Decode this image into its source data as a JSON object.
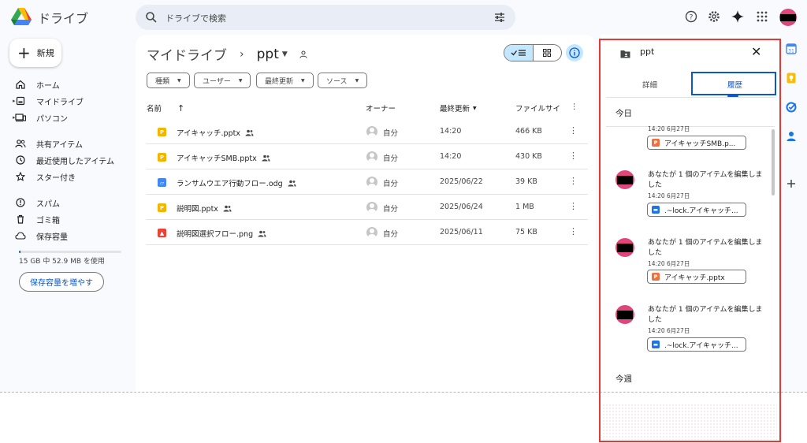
{
  "header": {
    "app_title": "ドライブ",
    "search_placeholder": "ドライブで検索"
  },
  "sidebar": {
    "new_label": "新規",
    "items": [
      {
        "label": "ホーム",
        "icon": "home-icon"
      },
      {
        "label": "マイドライブ",
        "icon": "drive-icon"
      },
      {
        "label": "パソコン",
        "icon": "computer-icon"
      },
      {
        "label": "共有アイテム",
        "icon": "shared-icon"
      },
      {
        "label": "最近使用したアイテム",
        "icon": "clock-icon"
      },
      {
        "label": "スター付き",
        "icon": "star-icon"
      },
      {
        "label": "スパム",
        "icon": "spam-icon"
      },
      {
        "label": "ゴミ箱",
        "icon": "trash-icon"
      },
      {
        "label": "保存容量",
        "icon": "cloud-icon"
      }
    ],
    "storage_text": "15 GB 中 52.9 MB を使用",
    "storage_fraction": 0.0034,
    "storage_button": "保存容量を増やす"
  },
  "main": {
    "breadcrumb_root": "マイドライブ",
    "breadcrumb_current": "ppt",
    "filters": [
      "種類",
      "ユーザー",
      "最終更新",
      "ソース"
    ],
    "columns": {
      "name": "名前",
      "owner": "オーナー",
      "modified": "最終更新",
      "size": "ファイルサイ"
    },
    "files": [
      {
        "name": "アイキャッチ.pptx",
        "type": "slides",
        "owner": "自分",
        "modified": "14:20",
        "size": "466 KB"
      },
      {
        "name": "アイキャッチSMB.pptx",
        "type": "slides",
        "owner": "自分",
        "modified": "14:20",
        "size": "430 KB"
      },
      {
        "name": "ランサムウエア行動フロー.odg",
        "type": "drawing",
        "owner": "自分",
        "modified": "2025/06/22",
        "size": "39 KB"
      },
      {
        "name": "説明図.pptx",
        "type": "slides",
        "owner": "自分",
        "modified": "2025/06/24",
        "size": "1 MB"
      },
      {
        "name": "説明図選択フロー.png",
        "type": "image",
        "owner": "自分",
        "modified": "2025/06/11",
        "size": "75 KB"
      }
    ]
  },
  "panel": {
    "title": "ppt",
    "tab_details": "詳細",
    "tab_activity": "履歴",
    "section_today": "今日",
    "section_week": "今週",
    "activities": [
      {
        "text": "",
        "time": "14:20 6月27日",
        "file": "アイキャッチSMB.p..."
      },
      {
        "text": "あなたが 1 個のアイテムを編集しました",
        "time": "14:20 6月27日",
        "file": ".~lock.アイキャッチ..."
      },
      {
        "text": "あなたが 1 個のアイテムを編集しました",
        "time": "14:20 6月27日",
        "file": "アイキャッチ.pptx"
      },
      {
        "text": "あなたが 1 個のアイテムを編集しました",
        "time": "14:20 6月27日",
        "file": ".~lock.アイキャッチ..."
      }
    ]
  },
  "colors": {
    "accent": "#0b57d0",
    "selected": "#c2e7ff",
    "highlight_border": "#e53935",
    "avatar": "#e0457b"
  }
}
